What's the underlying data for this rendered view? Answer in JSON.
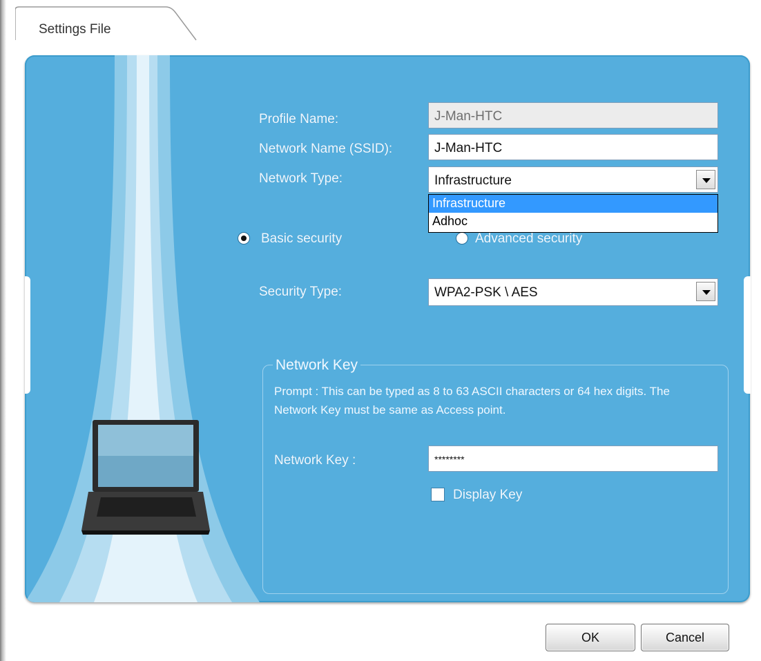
{
  "tab": {
    "title": "Settings File"
  },
  "form": {
    "profile_name_label": "Profile Name:",
    "profile_name_value": "J-Man-HTC",
    "ssid_label": "Network Name (SSID):",
    "ssid_value": "J-Man-HTC",
    "network_type_label": "Network Type:",
    "network_type_value": "Infrastructure",
    "network_type_options": [
      "Infrastructure",
      "Adhoc"
    ]
  },
  "security": {
    "basic_label": "Basic security",
    "advanced_label": "Advanced security",
    "selected": "Basic security",
    "type_label": "Security Type:",
    "type_value": "WPA2-PSK \\ AES"
  },
  "network_key": {
    "group_title": "Network Key",
    "prompt": "Prompt : This can be typed as 8 to 63 ASCII characters or 64 hex digits. The Network Key must be same as Access point.",
    "label": "Network Key :",
    "value": "********",
    "display_key_label": "Display Key",
    "display_key_checked": false
  },
  "buttons": {
    "ok": "OK",
    "cancel": "Cancel"
  },
  "colors": {
    "panel": "#55aedd",
    "selection": "#3399ff"
  }
}
